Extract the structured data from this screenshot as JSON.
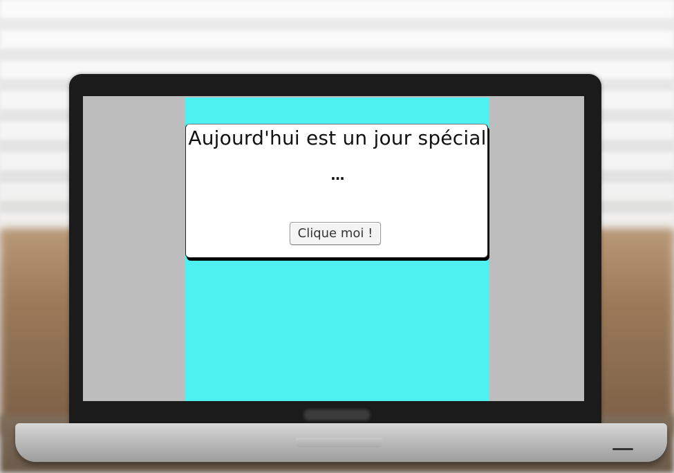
{
  "app": {
    "title": "Aujourd'hui est un jour spécial",
    "subtitle": "...",
    "button_label": "Clique moi !"
  },
  "colors": {
    "page_background": "#4ff0f0",
    "dialog_background": "#ffffff",
    "button_background": "#f4f4f4"
  }
}
